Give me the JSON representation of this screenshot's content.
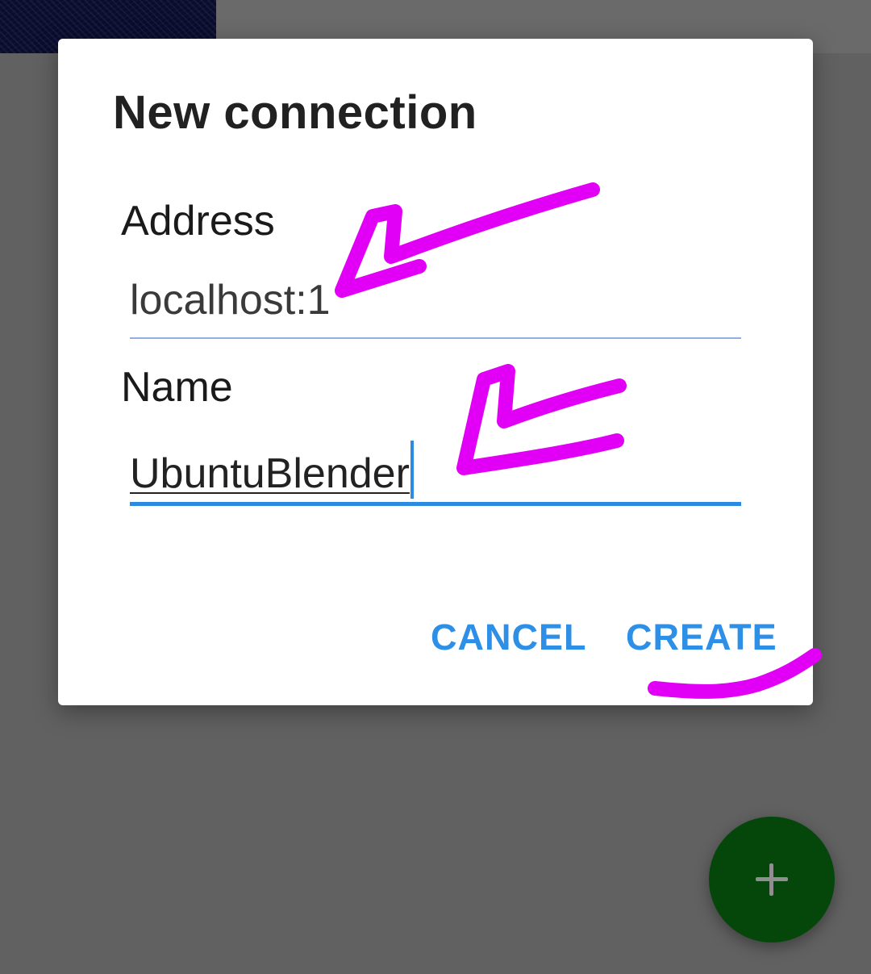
{
  "dialog": {
    "title": "New connection",
    "address": {
      "label": "Address",
      "value": "localhost:1"
    },
    "name": {
      "label": "Name",
      "value": "UbuntuBlender"
    },
    "cancel_label": "CANCEL",
    "create_label": "CREATE"
  },
  "fab": {
    "icon": "plus-icon"
  },
  "colors": {
    "accent": "#2e8fe6",
    "annotation": "#e100f5",
    "fab": "#05470a",
    "scrim": "#616161"
  }
}
